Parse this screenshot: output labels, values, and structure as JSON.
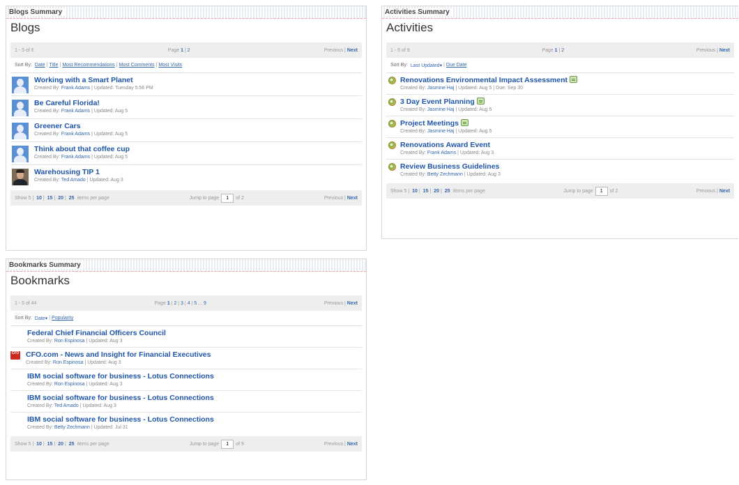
{
  "blogs": {
    "header": "Blogs Summary",
    "title": "Blogs",
    "range": "1 - 5 of 6",
    "page_label": "Page",
    "pages": [
      "1",
      "2"
    ],
    "previous": "Previous",
    "next": "Next",
    "sort_label": "Sort By:",
    "sort_options": [
      "Date",
      "Title",
      "Most Recommendations",
      "Most Comments",
      "Most Visits"
    ],
    "items": [
      {
        "title": "Working with a Smart Planet",
        "created_label": "Created By:",
        "author": "Frank Adams",
        "updated": "Updated: Tuesday 5:56 PM"
      },
      {
        "title": "Be Careful Florida!",
        "created_label": "Created By:",
        "author": "Frank Adams",
        "updated": "Updated: Aug 5"
      },
      {
        "title": "Greener Cars",
        "created_label": "Created By:",
        "author": "Frank Adams",
        "updated": "Updated: Aug 5"
      },
      {
        "title": "Think about that coffee cup",
        "created_label": "Created By:",
        "author": "Frank Adams",
        "updated": "Updated: Aug 5"
      },
      {
        "title": "Warehousing TIP 1",
        "created_label": "Created By:",
        "author": "Ted Amado",
        "updated": "Updated: Aug 3"
      }
    ],
    "show_label": "Show",
    "show_options": [
      "5",
      "10",
      "15",
      "20",
      "25"
    ],
    "items_per_page": "items per page",
    "jump_label": "Jump to page",
    "jump_value": "1",
    "jump_of": "of 2"
  },
  "activities": {
    "header": "Activities Summary",
    "title": "Activities",
    "range": "1 - 5 of 9",
    "page_label": "Page",
    "pages": [
      "1",
      "2"
    ],
    "previous": "Previous",
    "next": "Next",
    "sort_label": "Sort By:",
    "sort_options": [
      "Last Updated",
      "Due Date"
    ],
    "items": [
      {
        "title": "Renovations Environmental Impact Assessment",
        "created_label": "Created By:",
        "author": "Jasmine Haj",
        "updated": "Updated: Aug 5",
        "due": "Due: Sep 30"
      },
      {
        "title": "3 Day Event Planning",
        "created_label": "Created By:",
        "author": "Jasmine Haj",
        "updated": "Updated: Aug 5"
      },
      {
        "title": "Project Meetings",
        "created_label": "Created By:",
        "author": "Jasmine Haj",
        "updated": "Updated: Aug 5"
      },
      {
        "title": "Renovations Award Event",
        "created_label": "Created By:",
        "author": "Frank Adams",
        "updated": "Updated: Aug 3"
      },
      {
        "title": "Review Business Guidelines",
        "created_label": "Created By:",
        "author": "Betty Zechmann",
        "updated": "Updated: Aug 3"
      }
    ],
    "show_label": "Show",
    "show_options": [
      "5",
      "10",
      "15",
      "20",
      "25"
    ],
    "items_per_page": "items per page",
    "jump_label": "Jump to page",
    "jump_value": "1",
    "jump_of": "of 2"
  },
  "bookmarks": {
    "header": "Bookmarks Summary",
    "title": "Bookmarks",
    "range": "1 - 5 of 44",
    "page_label": "Page",
    "pages": [
      "1",
      "2",
      "3",
      "4",
      "5",
      "...",
      "9"
    ],
    "previous": "Previous",
    "next": "Next",
    "sort_label": "Sort By:",
    "sort_options": [
      "Date",
      "Popularity"
    ],
    "items": [
      {
        "title": "Federal Chief Financial Officers Council",
        "created_label": "Created By:",
        "author": "Ron Espinosa",
        "updated": "Updated: Aug 3"
      },
      {
        "title": "CFO.com - News and Insight for Financial Executives",
        "created_label": "Created By:",
        "author": "Ron Espinosa",
        "updated": "Updated: Aug 3"
      },
      {
        "title": "IBM social software for business - Lotus Connections",
        "created_label": "Created By:",
        "author": "Ron Espinosa",
        "updated": "Updated: Aug 3"
      },
      {
        "title": "IBM social software for business - Lotus Connections",
        "created_label": "Created By:",
        "author": "Ted Amado",
        "updated": "Updated: Aug 3"
      },
      {
        "title": "IBM social software for business - Lotus Connections",
        "created_label": "Created By:",
        "author": "Betty Zechmann",
        "updated": "Updated: Jul 31"
      }
    ],
    "cfo_icon_text": "CFO",
    "show_label": "Show",
    "show_options": [
      "5",
      "10",
      "15",
      "20",
      "25"
    ],
    "items_per_page": "items per page",
    "jump_label": "Jump to page",
    "jump_value": "1",
    "jump_of": "of 9"
  }
}
